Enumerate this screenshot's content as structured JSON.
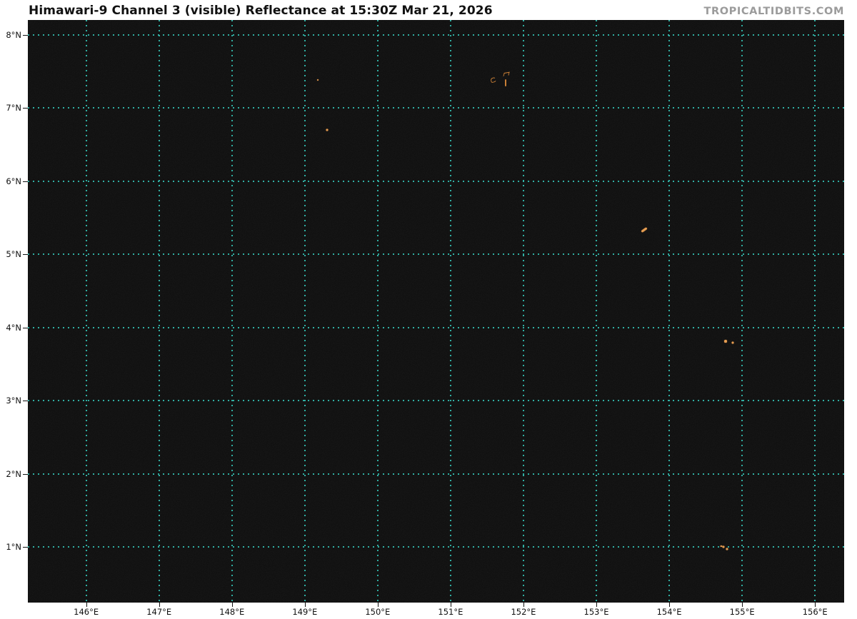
{
  "header": {
    "title": "Himawari-9 Channel 3 (visible) Reflectance at 15:30Z Mar 21, 2026",
    "brand": "TROPICALTIDBITS.COM",
    "satellite": "Himawari-9",
    "channel": "Channel 3 (visible)",
    "product": "Reflectance",
    "valid_time": "15:30Z Mar 21, 2026"
  },
  "colors": {
    "grid": "#33bfb2",
    "feature": "#c97f36",
    "feature_bright": "#e59d52",
    "map_bg": "#0d0d0d",
    "title_text": "#111111",
    "brand_text": "#9b9b9b",
    "axis_text": "#111111"
  },
  "map": {
    "bounds": {
      "lon_min": 145.2,
      "lon_max": 156.4,
      "lat_min": 0.24,
      "lat_max": 8.2
    },
    "lon_ticks": [
      {
        "lon": 146,
        "label": "146°E"
      },
      {
        "lon": 147,
        "label": "147°E"
      },
      {
        "lon": 148,
        "label": "148°E"
      },
      {
        "lon": 149,
        "label": "149°E"
      },
      {
        "lon": 150,
        "label": "150°E"
      },
      {
        "lon": 151,
        "label": "151°E"
      },
      {
        "lon": 152,
        "label": "152°E"
      },
      {
        "lon": 153,
        "label": "153°E"
      },
      {
        "lon": 154,
        "label": "154°E"
      },
      {
        "lon": 155,
        "label": "155°E"
      },
      {
        "lon": 156,
        "label": "156°E"
      }
    ],
    "lat_ticks": [
      {
        "lat": 8,
        "label": "8°N"
      },
      {
        "lat": 7,
        "label": "7°N"
      },
      {
        "lat": 6,
        "label": "6°N"
      },
      {
        "lat": 5,
        "label": "5°N"
      },
      {
        "lat": 4,
        "label": "4°N"
      },
      {
        "lat": 3,
        "label": "3°N"
      },
      {
        "lat": 2,
        "label": "2°N"
      },
      {
        "lat": 1,
        "label": "1°N"
      }
    ],
    "features": [
      {
        "name": "islet-dot",
        "type": "dot",
        "lon": 149.18,
        "lat": 7.38,
        "w": 2,
        "h": 2
      },
      {
        "name": "islet-dot",
        "type": "dot",
        "lon": 149.31,
        "lat": 6.7,
        "w": 3,
        "h": 3
      },
      {
        "name": "atoll-outline",
        "type": "loop",
        "lon": 151.59,
        "lat": 7.38,
        "w": 8,
        "h": 7,
        "rot": -15
      },
      {
        "name": "atoll-rim",
        "type": "quad",
        "lon": 151.77,
        "lat": 7.46,
        "w": 8,
        "h": 5,
        "rot": -10,
        "skew": -25
      },
      {
        "name": "island-sliver",
        "type": "vtick",
        "lon": 151.76,
        "lat": 7.34,
        "w": 2,
        "h": 10
      },
      {
        "name": "atoll-dash",
        "type": "dash",
        "lon": 153.66,
        "lat": 5.33,
        "w": 9,
        "h": 3,
        "rot": -35
      },
      {
        "name": "islet-dot",
        "type": "dot",
        "lon": 154.77,
        "lat": 3.81,
        "w": 4,
        "h": 4
      },
      {
        "name": "islet-dot",
        "type": "dot",
        "lon": 154.87,
        "lat": 3.79,
        "w": 3,
        "h": 3
      },
      {
        "name": "islet-dot",
        "type": "dot",
        "lon": 154.71,
        "lat": 1.01,
        "w": 3,
        "h": 2
      },
      {
        "name": "islet-dot",
        "type": "dot",
        "lon": 154.74,
        "lat": 1.0,
        "w": 3,
        "h": 3
      },
      {
        "name": "islet-dot",
        "type": "dot",
        "lon": 154.79,
        "lat": 0.97,
        "w": 3,
        "h": 3
      }
    ]
  }
}
